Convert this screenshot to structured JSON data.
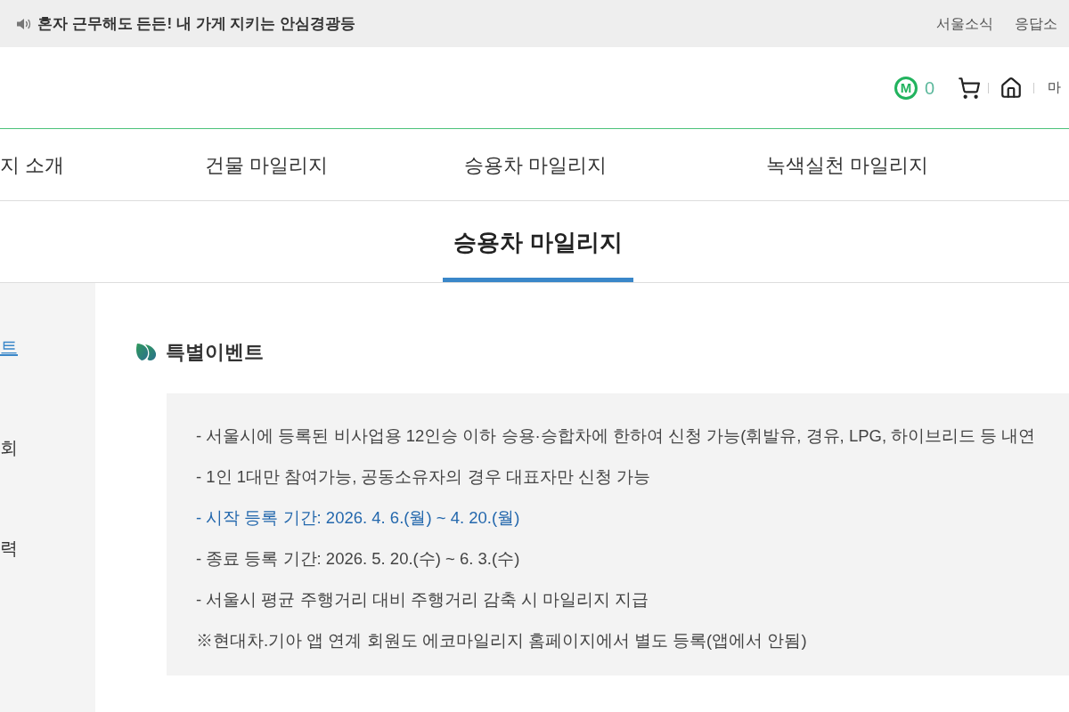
{
  "top_bar": {
    "notice": "혼자 근무해도 든든! 내 가게 지키는 안심경광등",
    "links": [
      "서울소식",
      "응답소"
    ]
  },
  "header": {
    "mileage_badge": "M",
    "mileage_count": "0",
    "menu_link": "마"
  },
  "nav": [
    "지 소개",
    "건물 마일리지",
    "승용차 마일리지",
    "녹색실천 마일리지"
  ],
  "page_title": "승용차 마일리지",
  "sidebar": {
    "items": [
      {
        "label": "트",
        "selected": true
      },
      {
        "label": "회",
        "selected": false
      },
      {
        "label": "력",
        "selected": false
      }
    ]
  },
  "section": {
    "title": "특별이벤트",
    "lines": [
      {
        "kind": "normal",
        "text": "- 서울시에 등록된 비사업용 12인승 이하 승용·승합차에 한하여 신청 가능(휘발유, 경유, LPG, 하이브리드 등 내연"
      },
      {
        "kind": "normal",
        "text": "- 1인 1대만 참여가능, 공동소유자의 경우 대표자만 신청 가능"
      },
      {
        "kind": "highlight",
        "text": "- 시작 등록 기간: 2026. 4. 6.(월) ~ 4. 20.(월)"
      },
      {
        "kind": "normal",
        "text": "- 종료 등록 기간: 2026. 5. 20.(수) ~ 6. 3.(수)"
      },
      {
        "kind": "normal",
        "text": "- 서울시 평균 주행거리 대비 주행거리 감축 시 마일리지 지급"
      },
      {
        "kind": "normal",
        "text": "※현대차.기아 앱 연계 회원도 에코마일리지 홈페이지에서 별도 등록(앱에서 안됨)"
      }
    ]
  }
}
